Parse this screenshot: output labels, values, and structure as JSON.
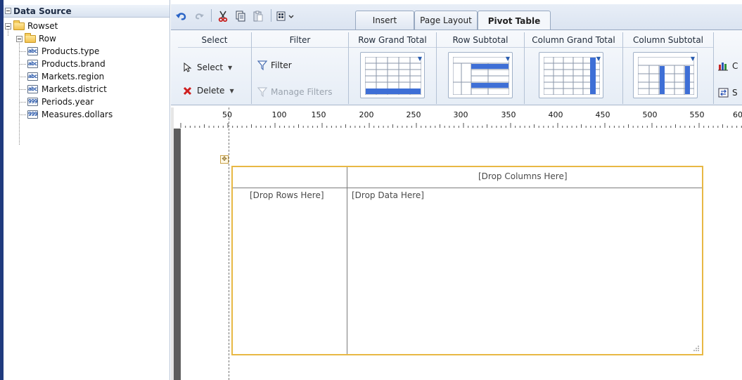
{
  "data_source": {
    "title": "Data Source",
    "tree": [
      {
        "label": "Rowset",
        "icon": "folder-icon"
      },
      {
        "label": "Row",
        "icon": "folder-icon"
      },
      {
        "label": "Products.type",
        "type_badge": "abc"
      },
      {
        "label": "Products.brand",
        "type_badge": "abc"
      },
      {
        "label": "Markets.region",
        "type_badge": "abc"
      },
      {
        "label": "Markets.district",
        "type_badge": "abc"
      },
      {
        "label": "Periods.year",
        "type_badge": "999"
      },
      {
        "label": "Measures.dollars",
        "type_badge": "999"
      }
    ]
  },
  "ribbon": {
    "tabs": [
      "Insert",
      "Page Layout",
      "Pivot Table"
    ],
    "active_tab": "Pivot Table",
    "groups": {
      "select": {
        "title": "Select",
        "select_label": "Select",
        "delete_label": "Delete"
      },
      "filter": {
        "title": "Filter",
        "filter_label": "Filter",
        "manage_filters_label": "Manage Filters"
      },
      "row_grand_total": {
        "title": "Row Grand Total"
      },
      "row_subtotal": {
        "title": "Row Subtotal"
      },
      "column_grand_total": {
        "title": "Column Grand Total"
      },
      "column_subtotal": {
        "title": "Column Subtotal"
      },
      "extra": {
        "chart_label_partial": "C",
        "switch_label_partial": "S"
      }
    }
  },
  "ruler": {
    "labels": [
      "50",
      "100",
      "150",
      "200",
      "250",
      "300",
      "350",
      "400",
      "450",
      "500",
      "550",
      "60"
    ]
  },
  "pivot_table": {
    "drop_columns": "[Drop Columns Here]",
    "drop_rows": "[Drop Rows Here]",
    "drop_data": "[Drop Data Here]"
  },
  "colors": {
    "accent_blue": "#3e6fd6",
    "selection_border": "#e8b844",
    "panel_accent": "#1f3a7e"
  }
}
